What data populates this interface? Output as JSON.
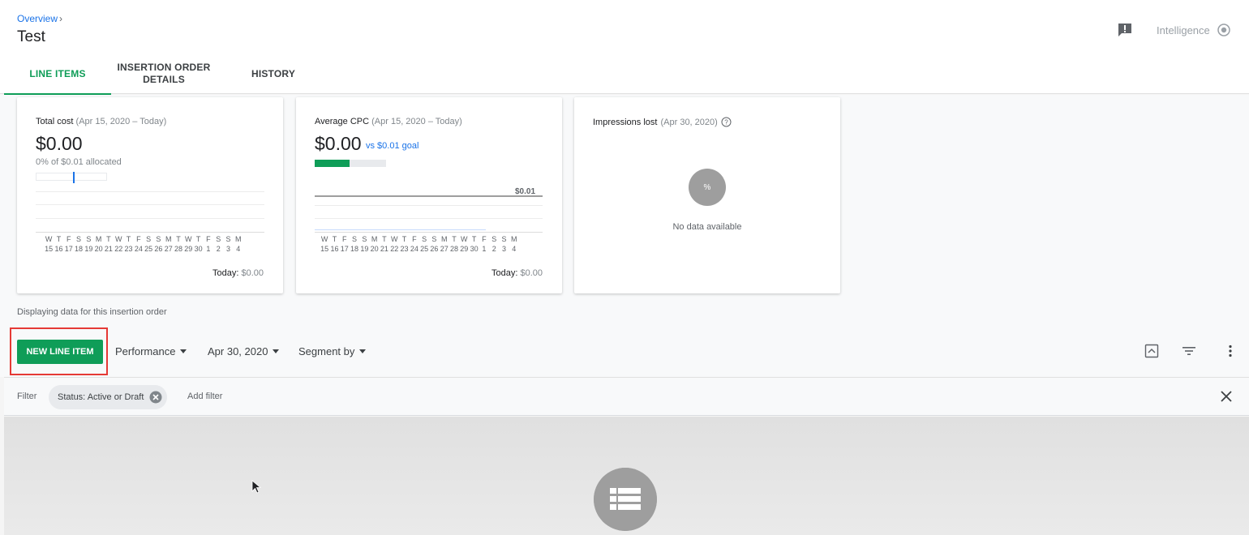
{
  "header": {
    "breadcrumb": "Overview",
    "breadcrumb_sep": "›",
    "title": "Test",
    "intelligence_label": "Intelligence"
  },
  "tabs": [
    {
      "label": "LINE ITEMS",
      "active": true
    },
    {
      "label_line1": "INSERTION ORDER",
      "label_line2": "DETAILS",
      "active": false
    },
    {
      "label": "HISTORY",
      "active": false
    }
  ],
  "cards": {
    "total_cost": {
      "title": "Total cost",
      "range": "(Apr 15, 2020 – Today)",
      "value": "$0.00",
      "sub": "0% of $0.01 allocated",
      "today_label": "Today:",
      "today_value": "$0.00"
    },
    "avg_cpc": {
      "title": "Average CPC",
      "range": "(Apr 15, 2020 – Today)",
      "value": "$0.00",
      "vs_goal": "vs $0.01 goal",
      "goal_label": "$0.01",
      "today_label": "Today:",
      "today_value": "$0.00"
    },
    "impressions_lost": {
      "title": "Impressions lost",
      "range": "(Apr 30, 2020)",
      "pct_symbol": "%",
      "no_data": "No data available"
    }
  },
  "axis": {
    "days": [
      "W",
      "T",
      "F",
      "S",
      "S",
      "M",
      "T",
      "W",
      "T",
      "F",
      "S",
      "S",
      "M",
      "T",
      "W",
      "T",
      "F",
      "S",
      "S",
      "M"
    ],
    "dates": [
      "15",
      "16",
      "17",
      "18",
      "19",
      "20",
      "21",
      "22",
      "23",
      "24",
      "25",
      "26",
      "27",
      "28",
      "29",
      "30",
      "1",
      "2",
      "3",
      "4"
    ]
  },
  "display_note": "Displaying data for this insertion order",
  "toolbar": {
    "new_line_item": "NEW LINE ITEM",
    "performance": "Performance",
    "date": "Apr 30, 2020",
    "segment_by": "Segment by"
  },
  "filter": {
    "label": "Filter",
    "chip": "Status: Active or Draft",
    "add_filter": "Add filter"
  },
  "colors": {
    "accent_green": "#0f9d58",
    "link_blue": "#1a73e8",
    "highlight_red": "#e53935"
  },
  "icons": [
    "feedback-icon",
    "intelligence-icon",
    "help-icon",
    "collapse-icon",
    "filter-icon",
    "more-vert-icon",
    "chip-remove-icon",
    "close-icon",
    "list-icon",
    "cursor-icon"
  ]
}
